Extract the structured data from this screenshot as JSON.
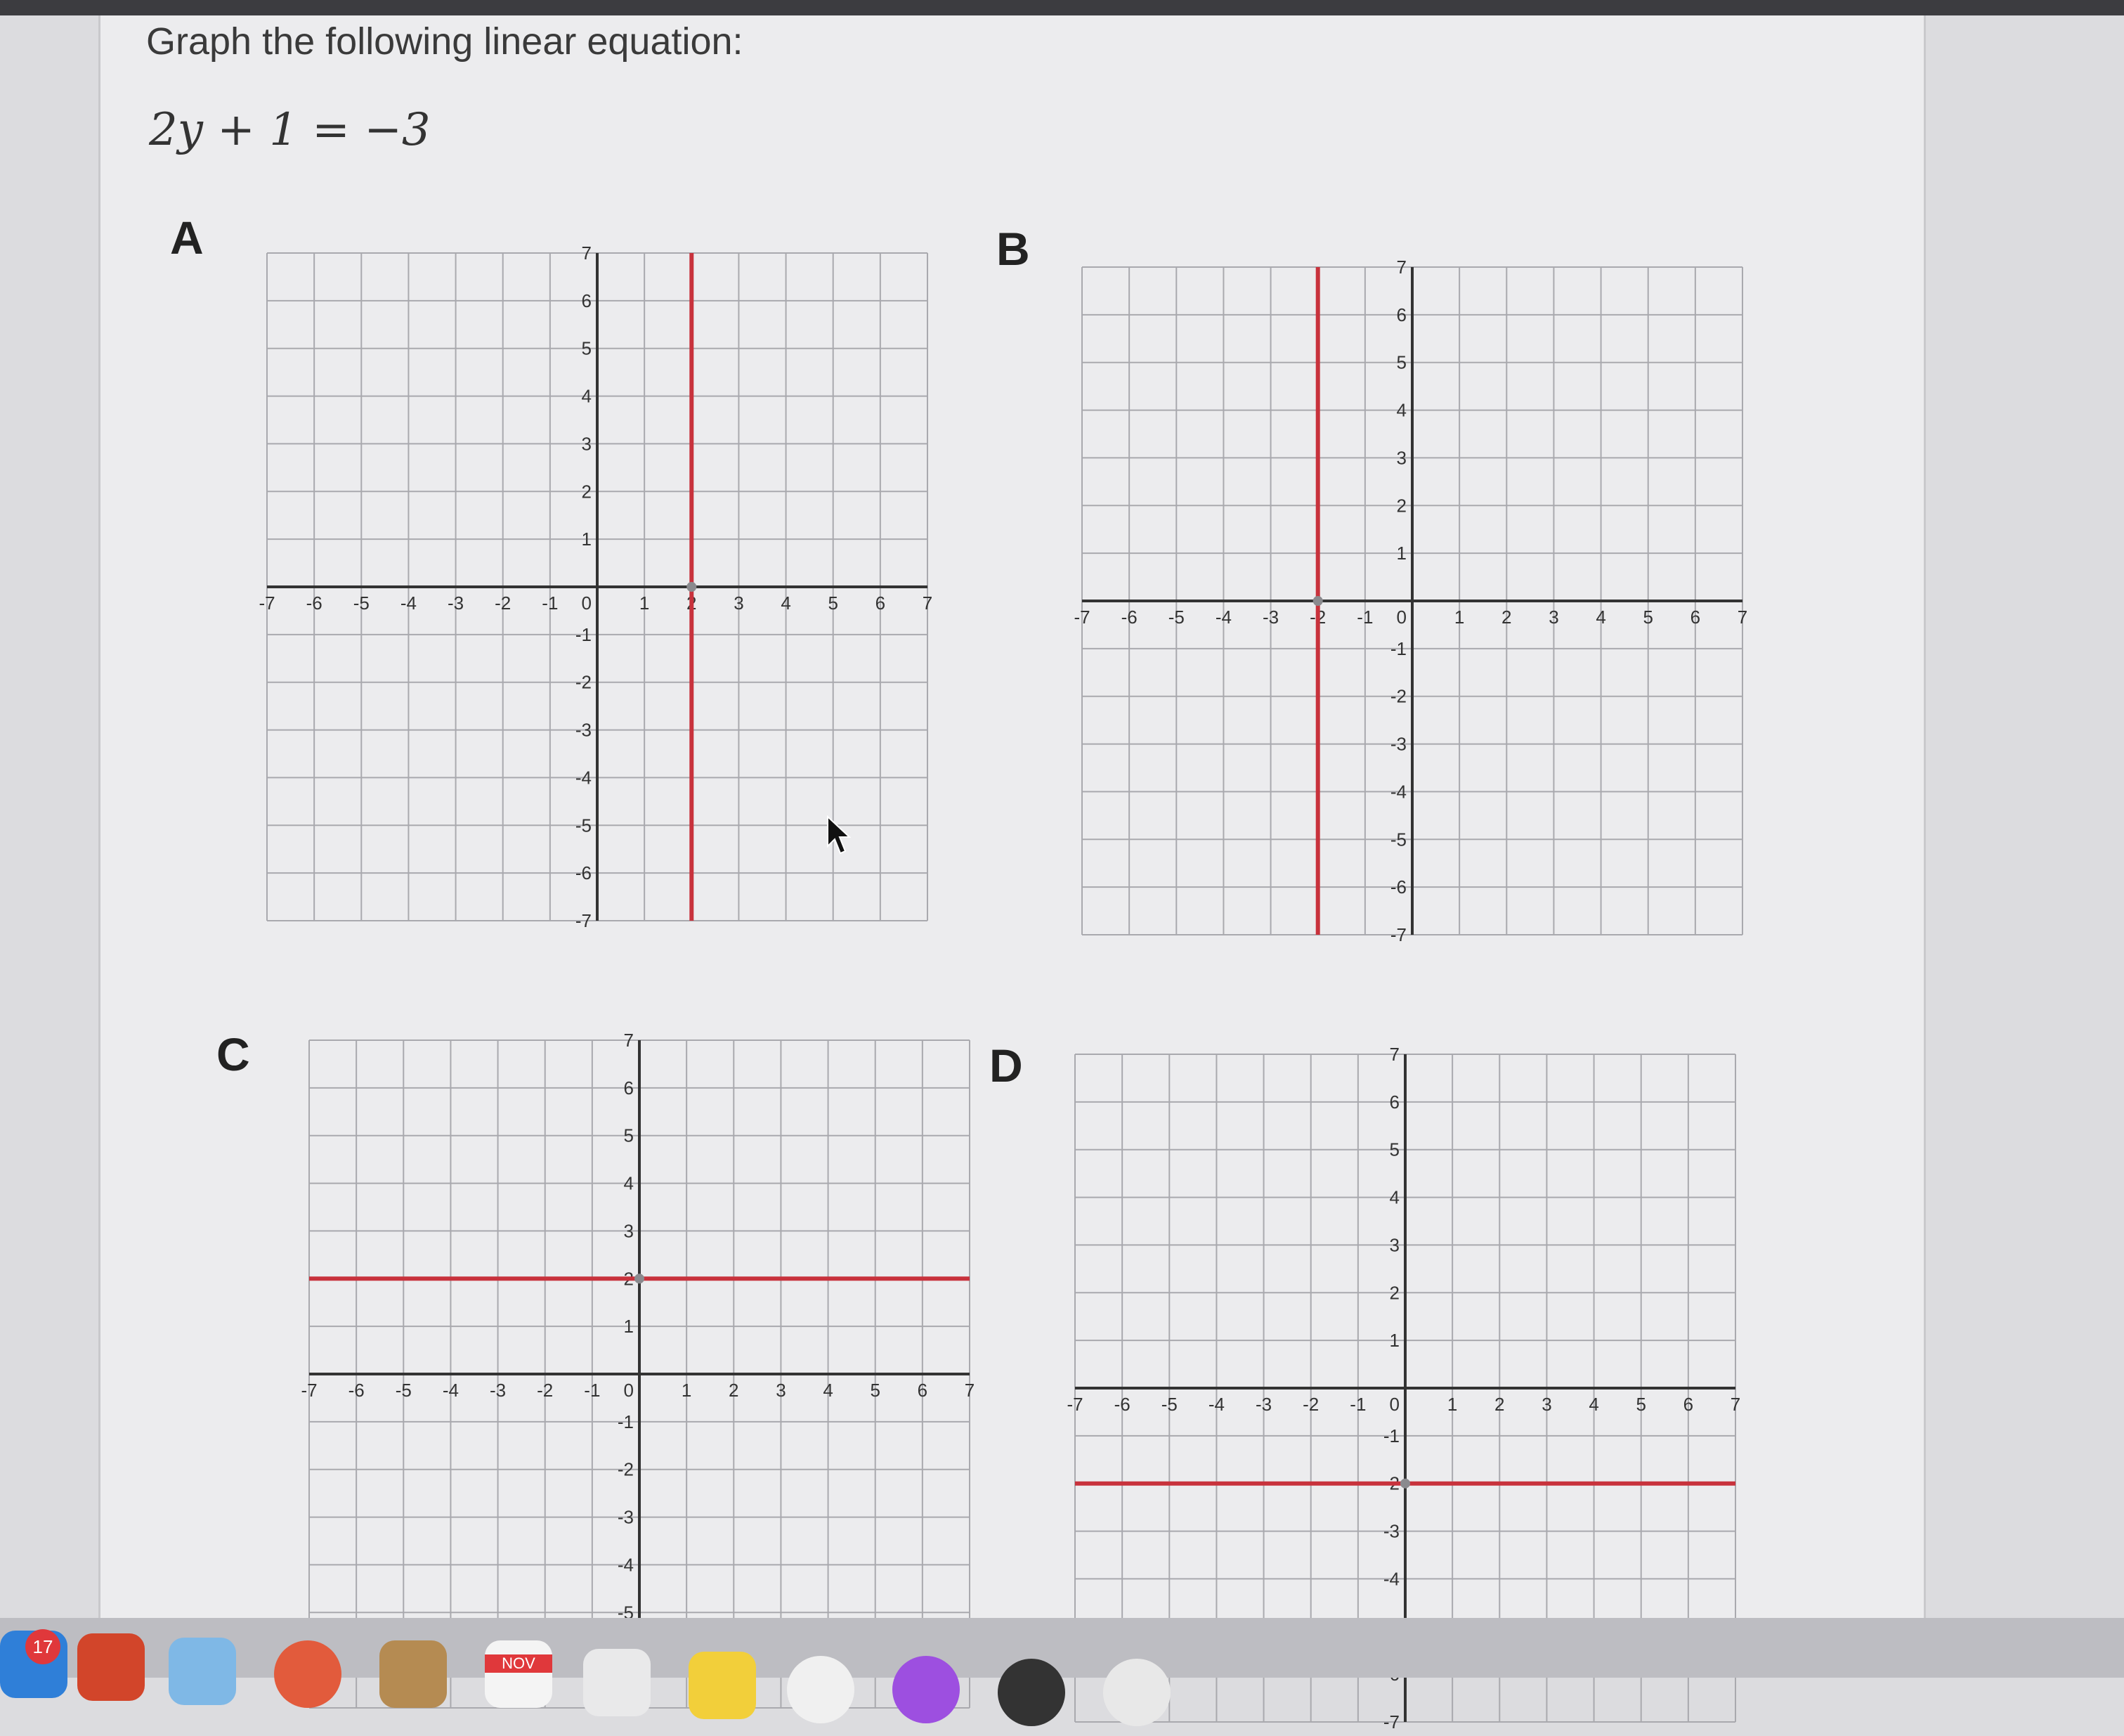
{
  "question": {
    "prompt": "Graph the following linear equation:",
    "equation": "2y + 1 = −3"
  },
  "options": [
    {
      "label": "A",
      "line": {
        "orientation": "vertical",
        "x": 2
      }
    },
    {
      "label": "B",
      "line": {
        "orientation": "vertical",
        "x": -2
      }
    },
    {
      "label": "C",
      "line": {
        "orientation": "horizontal",
        "y": 2
      }
    },
    {
      "label": "D",
      "line": {
        "orientation": "horizontal",
        "y": -2
      }
    }
  ],
  "axes": {
    "xlim": [
      -7,
      7
    ],
    "ylim": [
      -7,
      7
    ],
    "grid": true,
    "origin_label": "0"
  },
  "colors": {
    "line": "#c8323c",
    "grid": "#a9a9ae",
    "axis": "#333333"
  },
  "dock": {
    "notification_badge": "17",
    "calendar_month": "NOV"
  },
  "chart_data": [
    {
      "type": "line",
      "title": "A",
      "series": [
        {
          "x": [
            2,
            2
          ],
          "y": [
            -7,
            7
          ]
        }
      ],
      "xlim": [
        -7,
        7
      ],
      "ylim": [
        -7,
        7
      ]
    },
    {
      "type": "line",
      "title": "B",
      "series": [
        {
          "x": [
            -2,
            -2
          ],
          "y": [
            -7,
            7
          ]
        }
      ],
      "xlim": [
        -7,
        7
      ],
      "ylim": [
        -7,
        7
      ]
    },
    {
      "type": "line",
      "title": "C",
      "series": [
        {
          "x": [
            -7,
            7
          ],
          "y": [
            2,
            2
          ]
        }
      ],
      "xlim": [
        -7,
        7
      ],
      "ylim": [
        -7,
        7
      ]
    },
    {
      "type": "line",
      "title": "D",
      "series": [
        {
          "x": [
            -7,
            7
          ],
          "y": [
            -2,
            -2
          ]
        }
      ],
      "xlim": [
        -7,
        7
      ],
      "ylim": [
        -7,
        7
      ]
    }
  ]
}
